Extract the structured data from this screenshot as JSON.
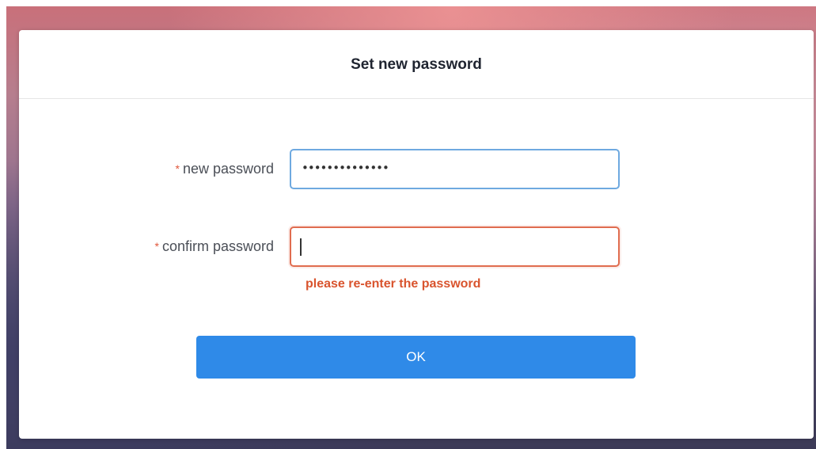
{
  "dialog": {
    "title": "Set new password"
  },
  "form": {
    "new_password": {
      "required_mark": "*",
      "label": "new password",
      "value_masked": "••••••••••••••"
    },
    "confirm_password": {
      "required_mark": "*",
      "label": "confirm password",
      "value": "",
      "error": "please re-enter the password"
    },
    "submit_label": "OK"
  },
  "colors": {
    "primary": "#2f8ae8",
    "focus_border": "#6ea9e0",
    "error": "#d9542e",
    "required": "#e0563a"
  }
}
